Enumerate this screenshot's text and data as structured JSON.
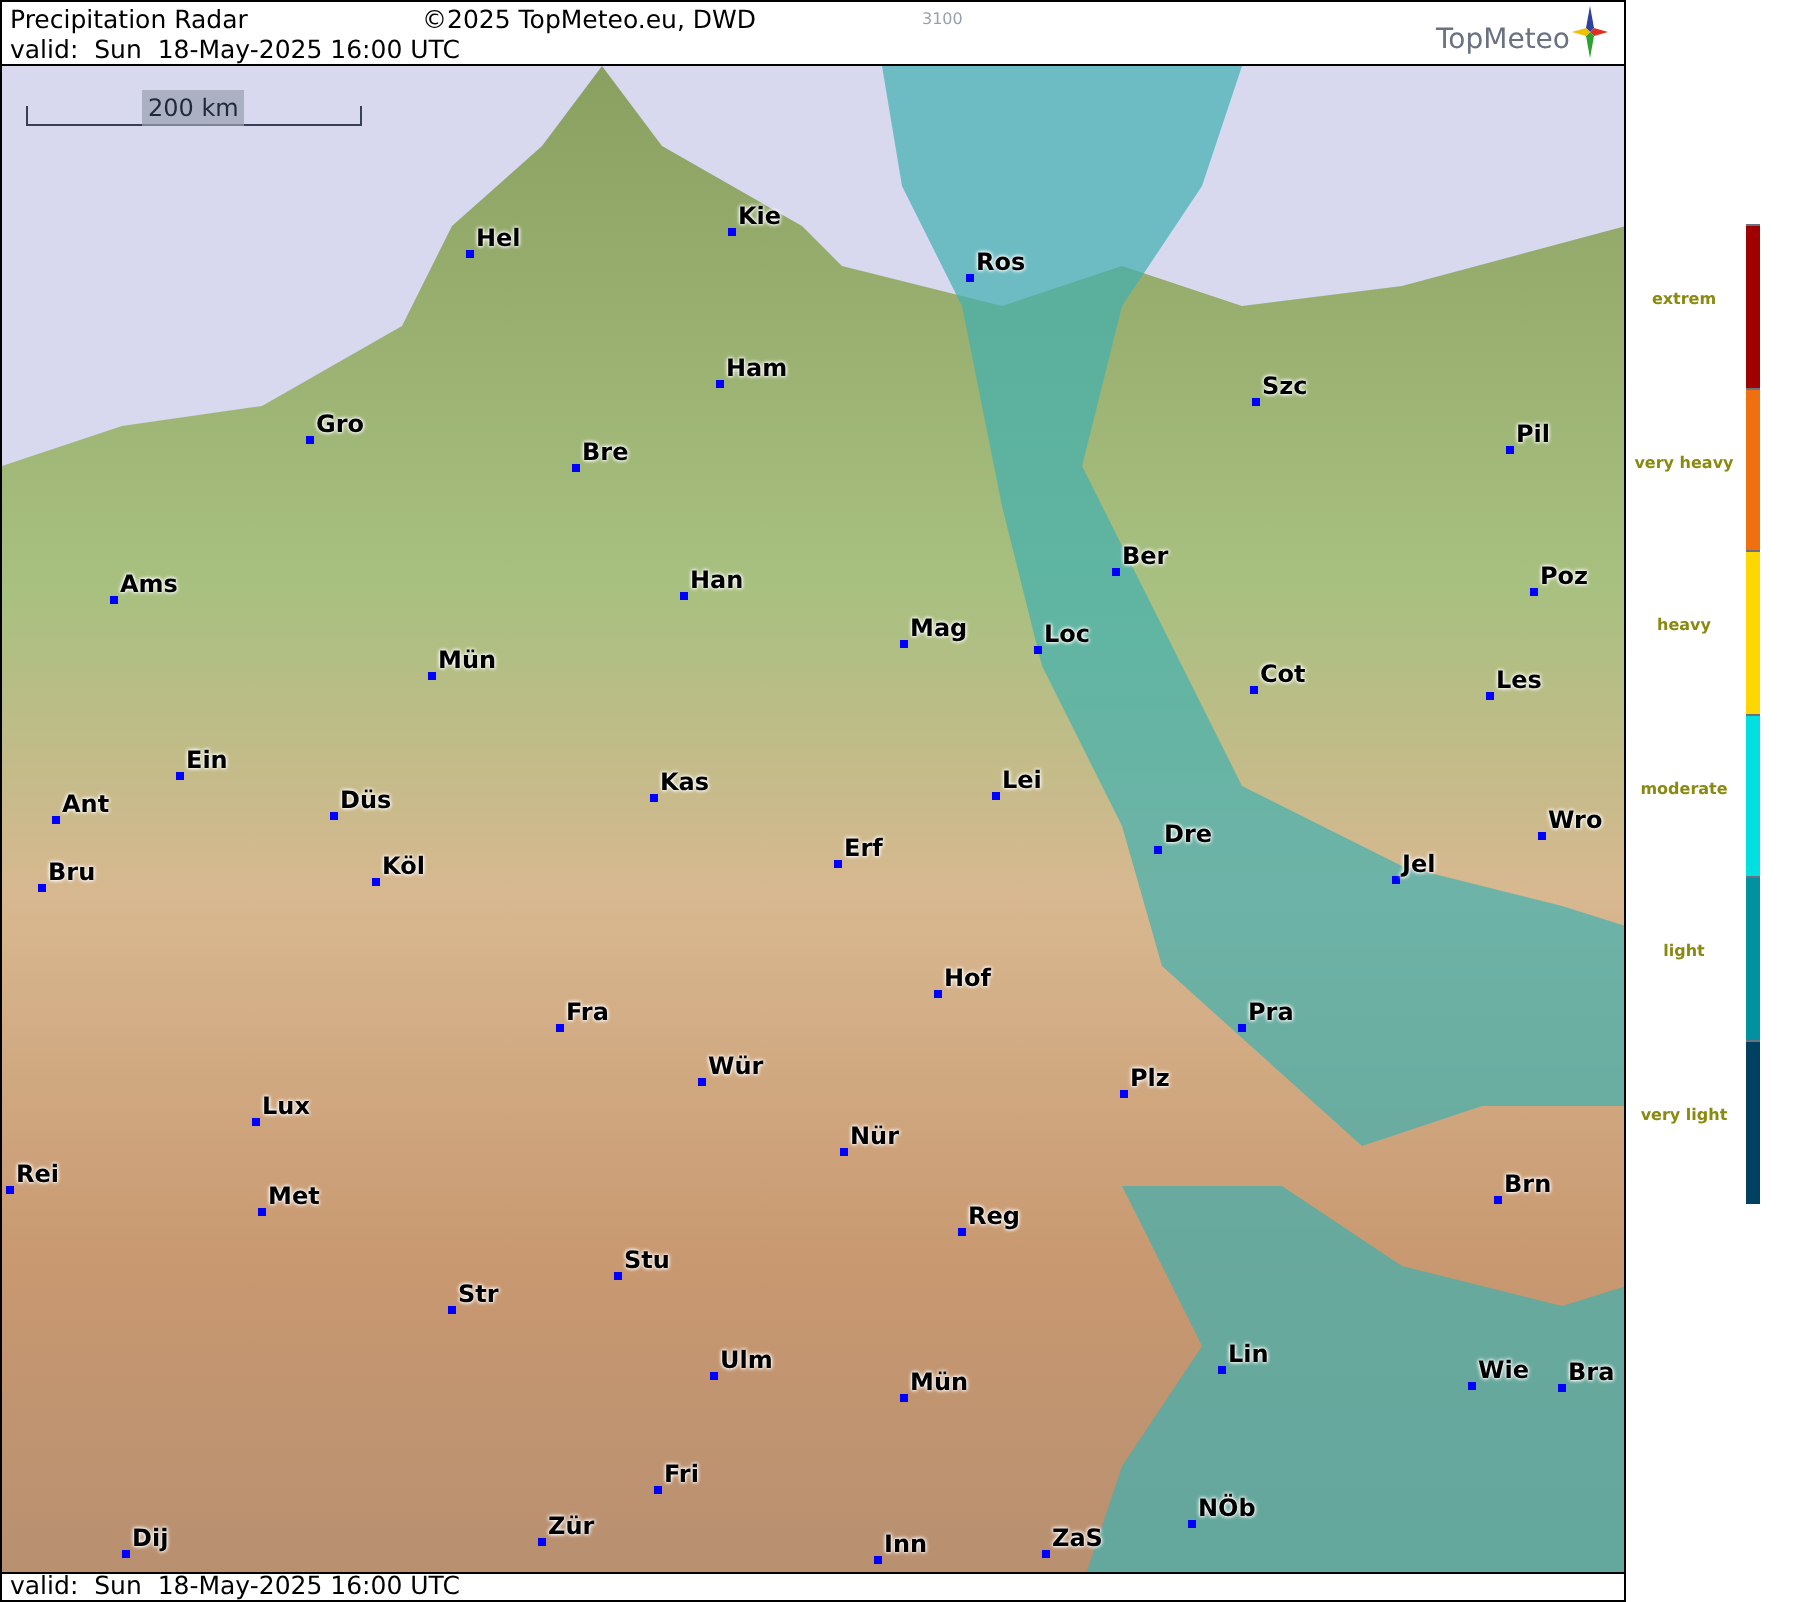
{
  "header": {
    "title": "Precipitation Radar",
    "copyright": "©2025 TopMeteo.eu, DWD",
    "code": "3100",
    "valid": "valid:  Sun  18-May-2025 16:00 UTC",
    "logo": "TopMeteo"
  },
  "map": {
    "scale": "200 km",
    "cities": [
      {
        "name": "Hel"
      },
      {
        "name": "Kie"
      },
      {
        "name": "Ros"
      },
      {
        "name": "Ham"
      },
      {
        "name": "Szc"
      },
      {
        "name": "Gro"
      },
      {
        "name": "Bre"
      },
      {
        "name": "Pil"
      },
      {
        "name": "Ber"
      },
      {
        "name": "Ams"
      },
      {
        "name": "Han"
      },
      {
        "name": "Poz"
      },
      {
        "name": "Mag"
      },
      {
        "name": "Loc"
      },
      {
        "name": "Mün"
      },
      {
        "name": "Cot"
      },
      {
        "name": "Les"
      },
      {
        "name": "Ein"
      },
      {
        "name": "Kas"
      },
      {
        "name": "Lei"
      },
      {
        "name": "Ant"
      },
      {
        "name": "Düs"
      },
      {
        "name": "Wro"
      },
      {
        "name": "Dre"
      },
      {
        "name": "Erf"
      },
      {
        "name": "Bru"
      },
      {
        "name": "Köl"
      },
      {
        "name": "Jel"
      },
      {
        "name": "Hof"
      },
      {
        "name": "Fra"
      },
      {
        "name": "Pra"
      },
      {
        "name": "Wür"
      },
      {
        "name": "Plz"
      },
      {
        "name": "Lux"
      },
      {
        "name": "Nür"
      },
      {
        "name": "Rei"
      },
      {
        "name": "Met"
      },
      {
        "name": "Brn"
      },
      {
        "name": "Reg"
      },
      {
        "name": "Stu"
      },
      {
        "name": "Str"
      },
      {
        "name": "Ulm"
      },
      {
        "name": "Lin"
      },
      {
        "name": "Mün"
      },
      {
        "name": "Wie"
      },
      {
        "name": "Bra"
      },
      {
        "name": "Fri"
      },
      {
        "name": "NÖb"
      },
      {
        "name": "Dij"
      },
      {
        "name": "Zür"
      },
      {
        "name": "Inn"
      },
      {
        "name": "ZaS"
      }
    ]
  },
  "footer": {
    "valid": "valid:  Sun  18-May-2025 16:00 UTC"
  },
  "legend": [
    {
      "label": "extrem",
      "color": "#a00000"
    },
    {
      "label": "very heavy",
      "color": "#f07010"
    },
    {
      "label": "heavy",
      "color": "#ffd700"
    },
    {
      "label": "moderate",
      "color": "#00e0e0"
    },
    {
      "label": "light",
      "color": "#0090a0"
    },
    {
      "label": "very light",
      "color": "#004060"
    }
  ]
}
